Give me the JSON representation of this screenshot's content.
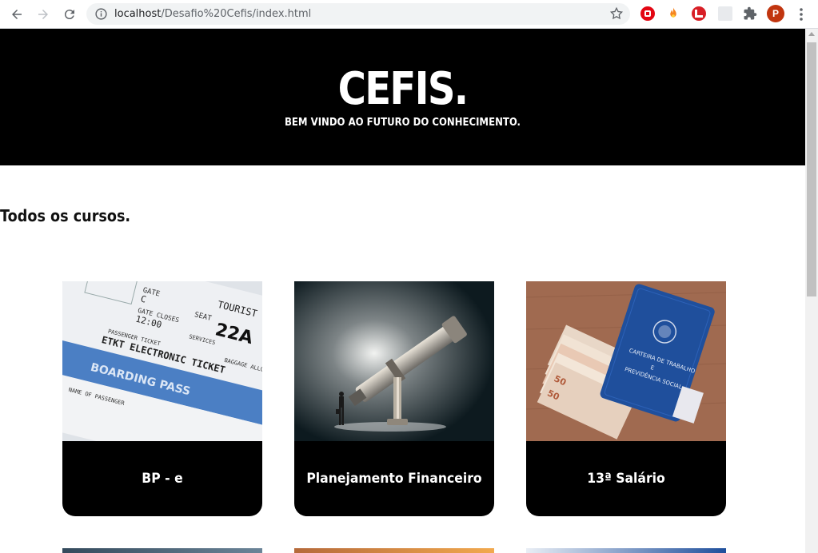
{
  "browser": {
    "url_host": "localhost",
    "url_path": "/Desafio%20Cefis/index.html",
    "avatar_letter": "P"
  },
  "hero": {
    "brand": "CEFIS.",
    "tagline": "BEM VINDO AO FUTURO DO CONHECIMENTO."
  },
  "section": {
    "title": "Todos os cursos."
  },
  "courses": [
    {
      "label": "BP - e",
      "image": "boarding-pass-ticket-image"
    },
    {
      "label": "Planejamento Financeiro",
      "image": "telescope-businessman-image"
    },
    {
      "label": "13ª Salário",
      "image": "work-card-cash-image"
    }
  ]
}
